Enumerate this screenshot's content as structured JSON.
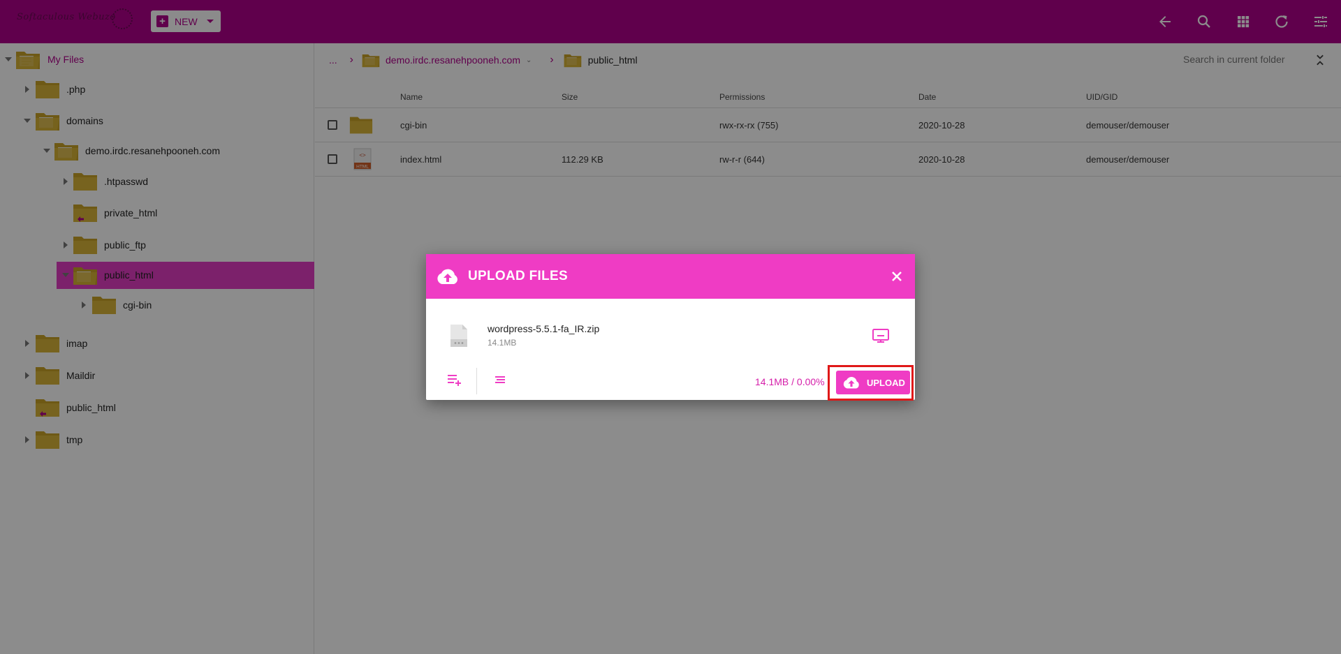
{
  "topbar": {
    "logo_text": "Softaculous Webuzo",
    "new_label": "NEW",
    "icons": [
      "back-arrow-icon",
      "search-icon",
      "grid-view-icon",
      "refresh-icon",
      "settings-sliders-icon"
    ],
    "bg_color": "#b0008a"
  },
  "sidebar": {
    "root_label": "My Files",
    "items": [
      {
        "label": ".php"
      },
      {
        "label": "domains"
      },
      {
        "label": "demo.irdc.resanehpooneh.com"
      },
      {
        "label": ".htpasswd"
      },
      {
        "label": "private_html"
      },
      {
        "label": "public_ftp"
      },
      {
        "label": "public_html"
      },
      {
        "label": "cgi-bin"
      },
      {
        "label": "imap"
      },
      {
        "label": "Maildir"
      },
      {
        "label": "public_html"
      },
      {
        "label": "tmp"
      }
    ]
  },
  "breadcrumb": {
    "ellipsis": "...",
    "domain": "demo.irdc.resanehpooneh.com",
    "current": "public_html"
  },
  "search": {
    "placeholder": "Search in current folder"
  },
  "table": {
    "headers": [
      "Name",
      "Size",
      "Permissions",
      "Date",
      "UID/GID"
    ],
    "rows": [
      {
        "name": "cgi-bin",
        "size": "",
        "permissions": "rwx-rx-rx (755)",
        "date": "2020-10-28",
        "owner": "demouser/demouser",
        "icon": "folder-icon"
      },
      {
        "name": "index.html",
        "size": "112.29 KB",
        "permissions": "rw-r-r (644)",
        "date": "2020-10-28",
        "owner": "demouser/demouser",
        "icon": "html-file-icon"
      }
    ]
  },
  "dialog": {
    "title": "UPLOAD FILES",
    "file_name": "wordpress-5.5.1-fa_IR.zip",
    "file_size": "14.1MB",
    "progress": "14.1MB / 0.00%",
    "progress_fraction": 0.0,
    "upload_label": "UPLOAD",
    "accent_color": "#ef3cc4"
  }
}
